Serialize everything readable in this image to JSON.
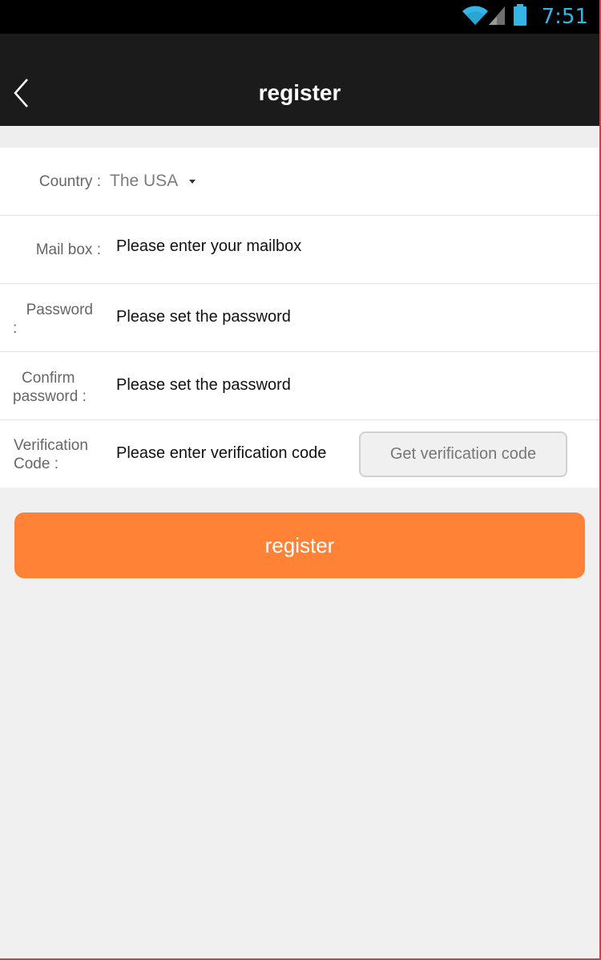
{
  "status_bar": {
    "time": "7:51",
    "icons": [
      "wifi-icon",
      "signal-icon",
      "battery-icon"
    ],
    "accent_color": "#33b5e5"
  },
  "header": {
    "back_icon": "chevron-left-icon",
    "title": "register"
  },
  "form": {
    "country": {
      "label": "Country :",
      "value": "The USA"
    },
    "mailbox": {
      "label": "Mail box :",
      "placeholder": "Please enter your mailbox",
      "value": ""
    },
    "password": {
      "label": "Password\n:",
      "placeholder": "Please set the password",
      "value": ""
    },
    "confirm_password": {
      "label": "Confirm\npassword :",
      "placeholder": "Please set the password",
      "value": ""
    },
    "verification": {
      "label": "Verification\nCode :",
      "placeholder": "Please enter verification code",
      "value": "",
      "button_label": "Get verification code"
    }
  },
  "register_button": {
    "label": "register",
    "color": "#ff8236"
  }
}
